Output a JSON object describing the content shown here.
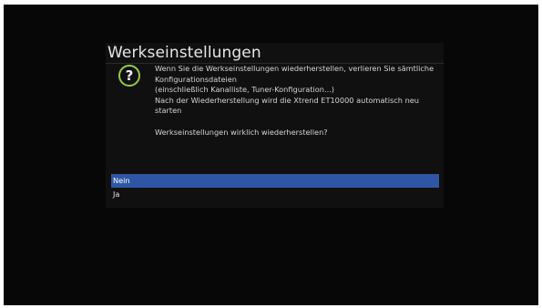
{
  "dialog": {
    "title": "Werkseinstellungen",
    "icon": "question-mark-icon",
    "message_lines": [
      "Wenn Sie die Werkseinstellungen wiederherstellen, verlieren Sie sämtliche",
      "Konfigurationsdateien",
      "(einschließlich Kanalliste, Tuner-Konfiguration...)",
      "Nach der Wiederherstellung wird die Xtrend ET10000 automatisch neu",
      "starten"
    ],
    "question": "Werkseinstellungen wirklich wiederherstellen?",
    "choices": [
      {
        "label": "Nein",
        "selected": true
      },
      {
        "label": "Ja",
        "selected": false
      }
    ],
    "colors": {
      "selection": "#2f56a6",
      "icon_ring": "#97c94a"
    }
  }
}
